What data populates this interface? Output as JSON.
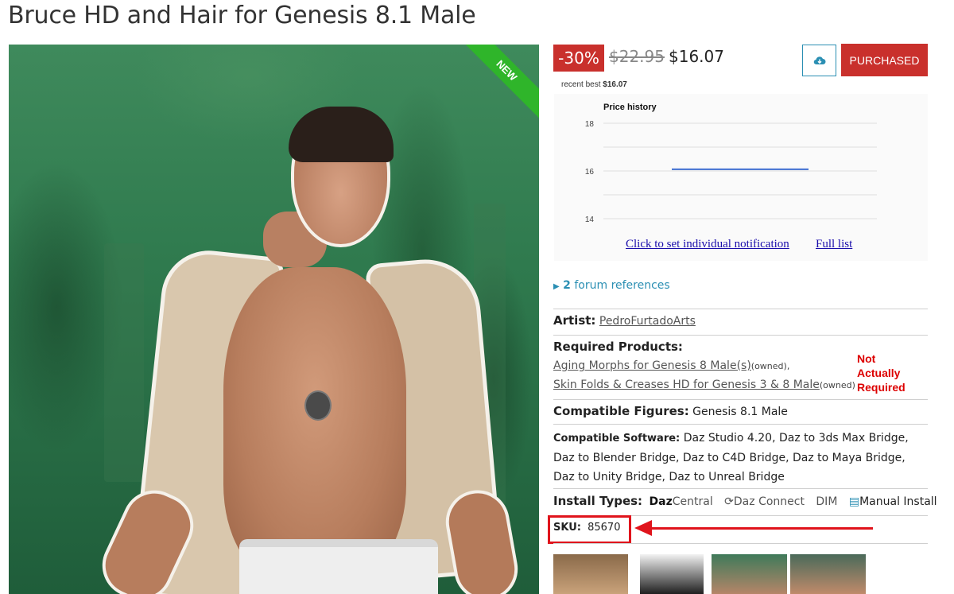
{
  "page": {
    "title": "Bruce HD and Hair for Genesis 8.1 Male"
  },
  "image": {
    "badge": "NEW"
  },
  "pricing": {
    "discount": "-30%",
    "old_price": "$22.95",
    "new_price": "$16.07",
    "recent_best_label": "recent best",
    "recent_best_value": "$16.07",
    "purchased_label": "PURCHASED",
    "cloud_icon": "cloud-download-icon"
  },
  "chart_data": {
    "type": "line",
    "title": "Price history",
    "y_ticks": [
      18,
      16,
      14
    ],
    "ylim": [
      13.5,
      18.5
    ],
    "grid": true,
    "series": [
      {
        "values": [
          16.07,
          16.07
        ],
        "color": "#3f6fd1"
      }
    ]
  },
  "links": {
    "notify": "Click to set individual notification",
    "full_list": "Full list"
  },
  "forum": {
    "count": "2",
    "label": "forum references",
    "icon": "triangle-right-icon"
  },
  "artist": {
    "label": "Artist:",
    "name": "PedroFurtadoArts"
  },
  "required": {
    "label": "Required Products:",
    "items": [
      {
        "name": "Aging Morphs for Genesis 8 Male(s)",
        "status": "(owned),"
      },
      {
        "name": "Skin Folds & Creases HD for Genesis 3 & 8 Male",
        "status": "(owned)"
      }
    ],
    "annotation": "Not Actually Required"
  },
  "figures": {
    "label": "Compatible Figures:",
    "value": "Genesis 8.1 Male"
  },
  "software": {
    "label": "Compatible Software:",
    "value": "Daz Studio 4.20, Daz to 3ds Max Bridge, Daz to Blender Bridge, Daz to C4D Bridge, Daz to Maya Bridge, Daz to Unity Bridge, Daz to Unreal Bridge"
  },
  "install": {
    "label": "Install Types:",
    "daz_central_strong": "Daz",
    "daz_central_rest": "Central",
    "daz_connect": "Daz Connect",
    "dim": "DIM",
    "manual": "Manual Install"
  },
  "sku": {
    "label": "SKU:",
    "value": "85670"
  },
  "colors": {
    "accent_red": "#c9302c",
    "link_blue": "#2b8fb3",
    "annotation_red": "#e0141c"
  }
}
